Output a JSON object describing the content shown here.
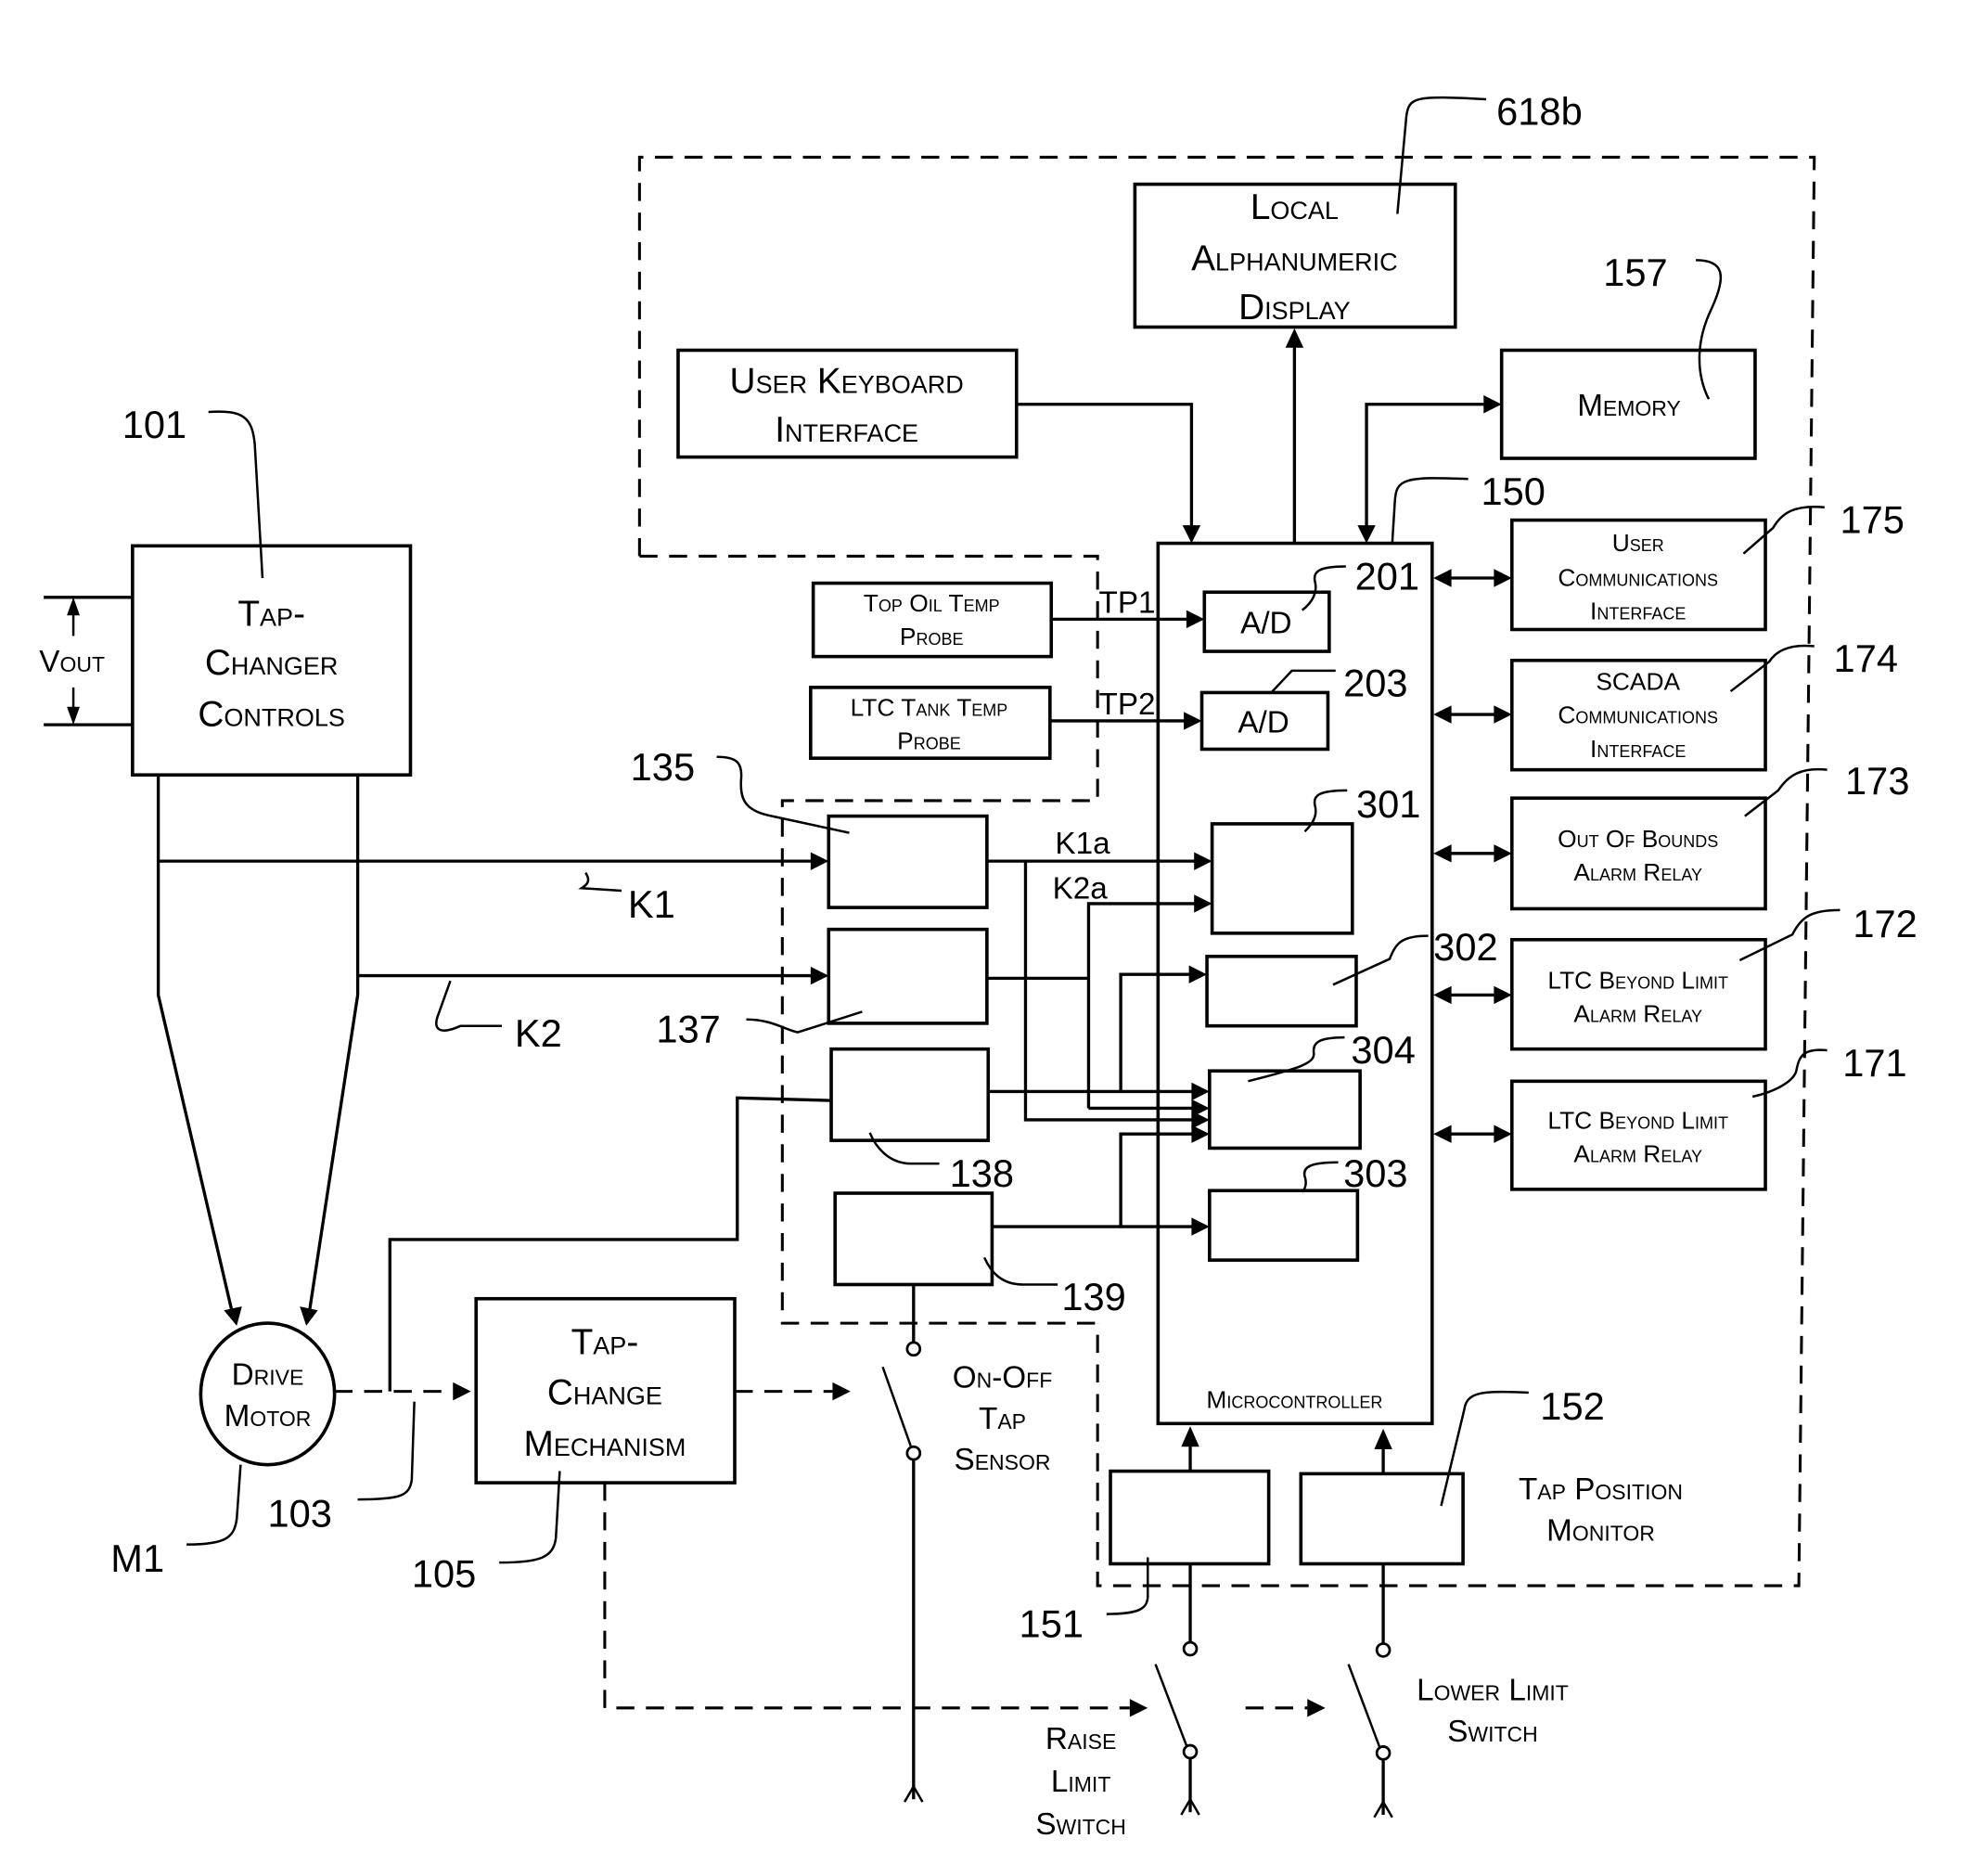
{
  "figure": {
    "blocks": {
      "local_display": [
        "Local",
        "Alphanumeric",
        "Display"
      ],
      "user_keyboard": [
        "User Keyboard",
        "Interface"
      ],
      "memory": [
        "Memory"
      ],
      "tap_changer_controls": [
        "Tap-",
        "Changer",
        "Controls"
      ],
      "top_oil_probe": [
        "Top Oil Temp",
        "Probe"
      ],
      "ltc_tank_probe": [
        "LTC Tank Temp",
        "Probe"
      ],
      "ad_1": "A/D",
      "ad_2": "A/D",
      "user_comm": [
        "User",
        "Communications",
        "Interface"
      ],
      "scada_comm": [
        "SCADA",
        "Communications",
        "Interface"
      ],
      "out_of_bounds": [
        "Out Of Bounds",
        "Alarm Relay"
      ],
      "ltc_beyond_1": [
        "LTC Beyond Limit",
        "Alarm Relay"
      ],
      "ltc_beyond_2": [
        "LTC Beyond Limit",
        "Alarm Relay"
      ],
      "microcontroller": "Microcontroller",
      "drive_motor": [
        "Drive",
        "Motor"
      ],
      "tap_change_mechanism": [
        "Tap-",
        "Change",
        "Mechanism"
      ]
    },
    "labels": {
      "vout": "Vout",
      "tp1": "TP1",
      "tp2": "TP2",
      "k1": "K1",
      "k2": "K2",
      "k1a": "K1a",
      "k2a": "K2a",
      "on_off_tap_sensor": [
        "On-Off",
        "Tap",
        "Sensor"
      ],
      "tap_position_monitor": [
        "Tap Position",
        "Monitor"
      ],
      "raise_limit_switch": [
        "Raise",
        "Limit",
        "Switch"
      ],
      "lower_limit_switch": [
        "Lower Limit",
        "Switch"
      ]
    },
    "refs": {
      "r618b": "618b",
      "r157": "157",
      "r150": "150",
      "r101": "101",
      "r175": "175",
      "r174": "174",
      "r173": "173",
      "r172": "172",
      "r171": "171",
      "r201": "201",
      "r203": "203",
      "r301": "301",
      "r302": "302",
      "r304": "304",
      "r303": "303",
      "r135": "135",
      "r137": "137",
      "r138": "138",
      "r139": "139",
      "r103": "103",
      "r105": "105",
      "m1": "M1",
      "r151": "151",
      "r152": "152"
    }
  }
}
